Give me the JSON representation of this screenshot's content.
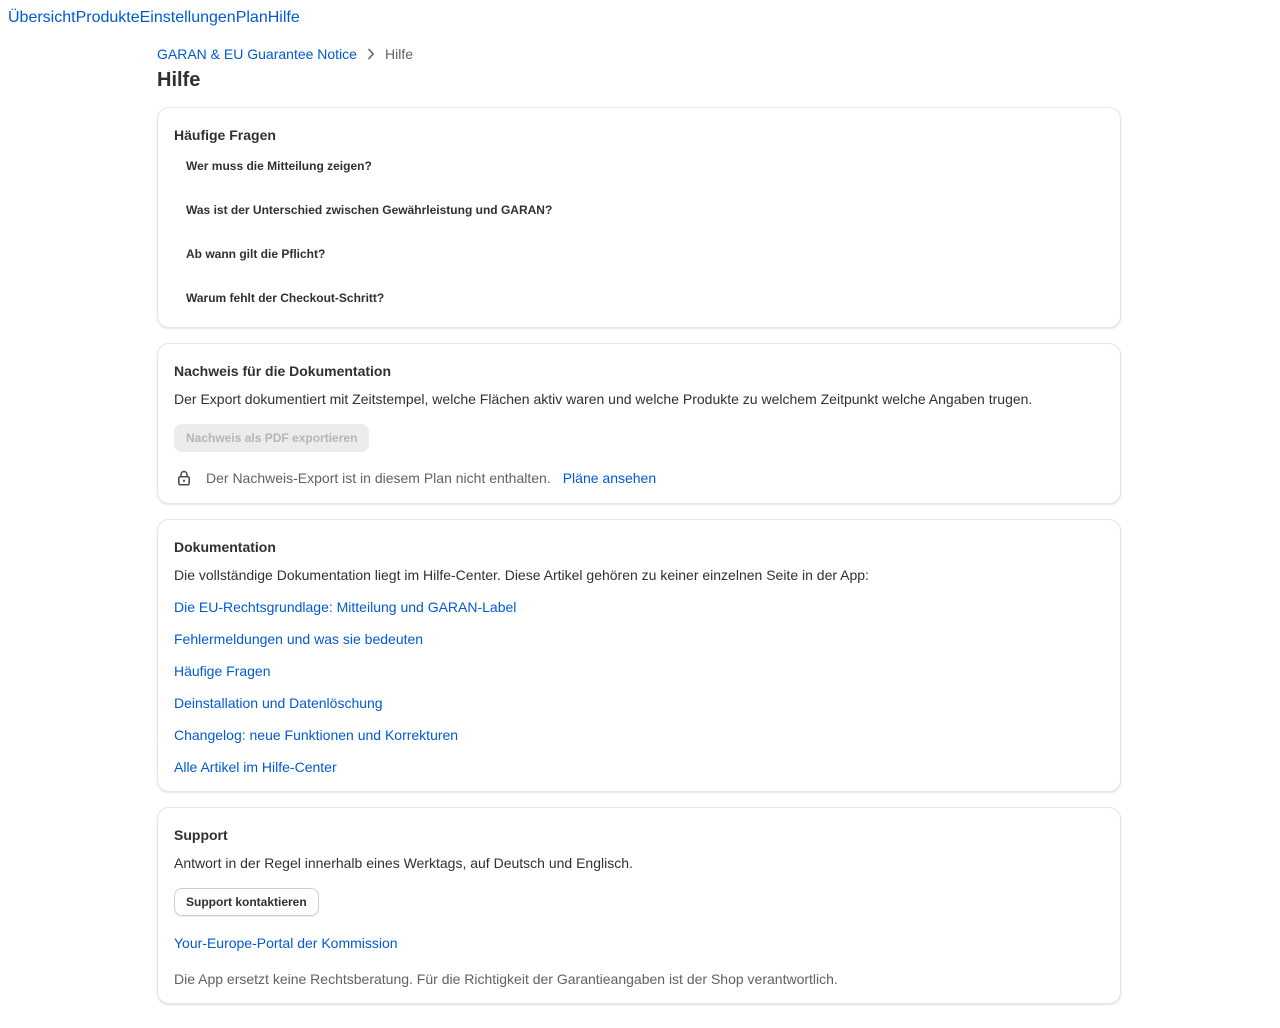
{
  "nav": [
    "Übersicht",
    "Produkte",
    "Einstellungen",
    "Plan",
    "Hilfe"
  ],
  "breadcrumb": {
    "parent": "GARAN & EU Guarantee Notice",
    "current": "Hilfe"
  },
  "page_title": "Hilfe",
  "faq": {
    "title": "Häufige Fragen",
    "items": [
      "Wer muss die Mitteilung zeigen?",
      "Was ist der Unterschied zwischen Gewährleistung und GARAN?",
      "Ab wann gilt die Pflicht?",
      "Warum fehlt der Checkout-Schritt?"
    ]
  },
  "proof": {
    "title": "Nachweis für die Dokumentation",
    "description": "Der Export dokumentiert mit Zeitstempel, welche Flächen aktiv waren und welche Produkte zu welchem Zeitpunkt welche Angaben trugen.",
    "export_button": "Nachweis als PDF exportieren",
    "locked_notice": "Der Nachweis-Export ist in diesem Plan nicht enthalten.",
    "plans_link": "Pläne ansehen"
  },
  "docs": {
    "title": "Dokumentation",
    "intro": "Die vollständige Dokumentation liegt im Hilfe-Center. Diese Artikel gehören zu keiner einzelnen Seite in der App:",
    "links": [
      "Die EU-Rechtsgrundlage: Mitteilung und GARAN-Label",
      "Fehlermeldungen und was sie bedeuten",
      "Häufige Fragen",
      "Deinstallation und Datenlöschung",
      "Changelog: neue Funktionen und Korrekturen",
      "Alle Artikel im Hilfe-Center"
    ]
  },
  "support": {
    "title": "Support",
    "description": "Antwort in der Regel innerhalb eines Werktags, auf Deutsch und Englisch.",
    "contact_button": "Support kontaktieren",
    "portal_link": "Your-Europe-Portal der Kommission",
    "disclaimer": "Die App ersetzt keine Rechtsberatung. Für die Richtigkeit der Garantieangaben ist der Shop verantwortlich."
  },
  "icons": {
    "breadcrumb_separator": "chevron-right-icon",
    "lock": "lock-icon"
  },
  "colors": {
    "link": "#005bd3",
    "text": "#303030",
    "muted": "#616161"
  }
}
